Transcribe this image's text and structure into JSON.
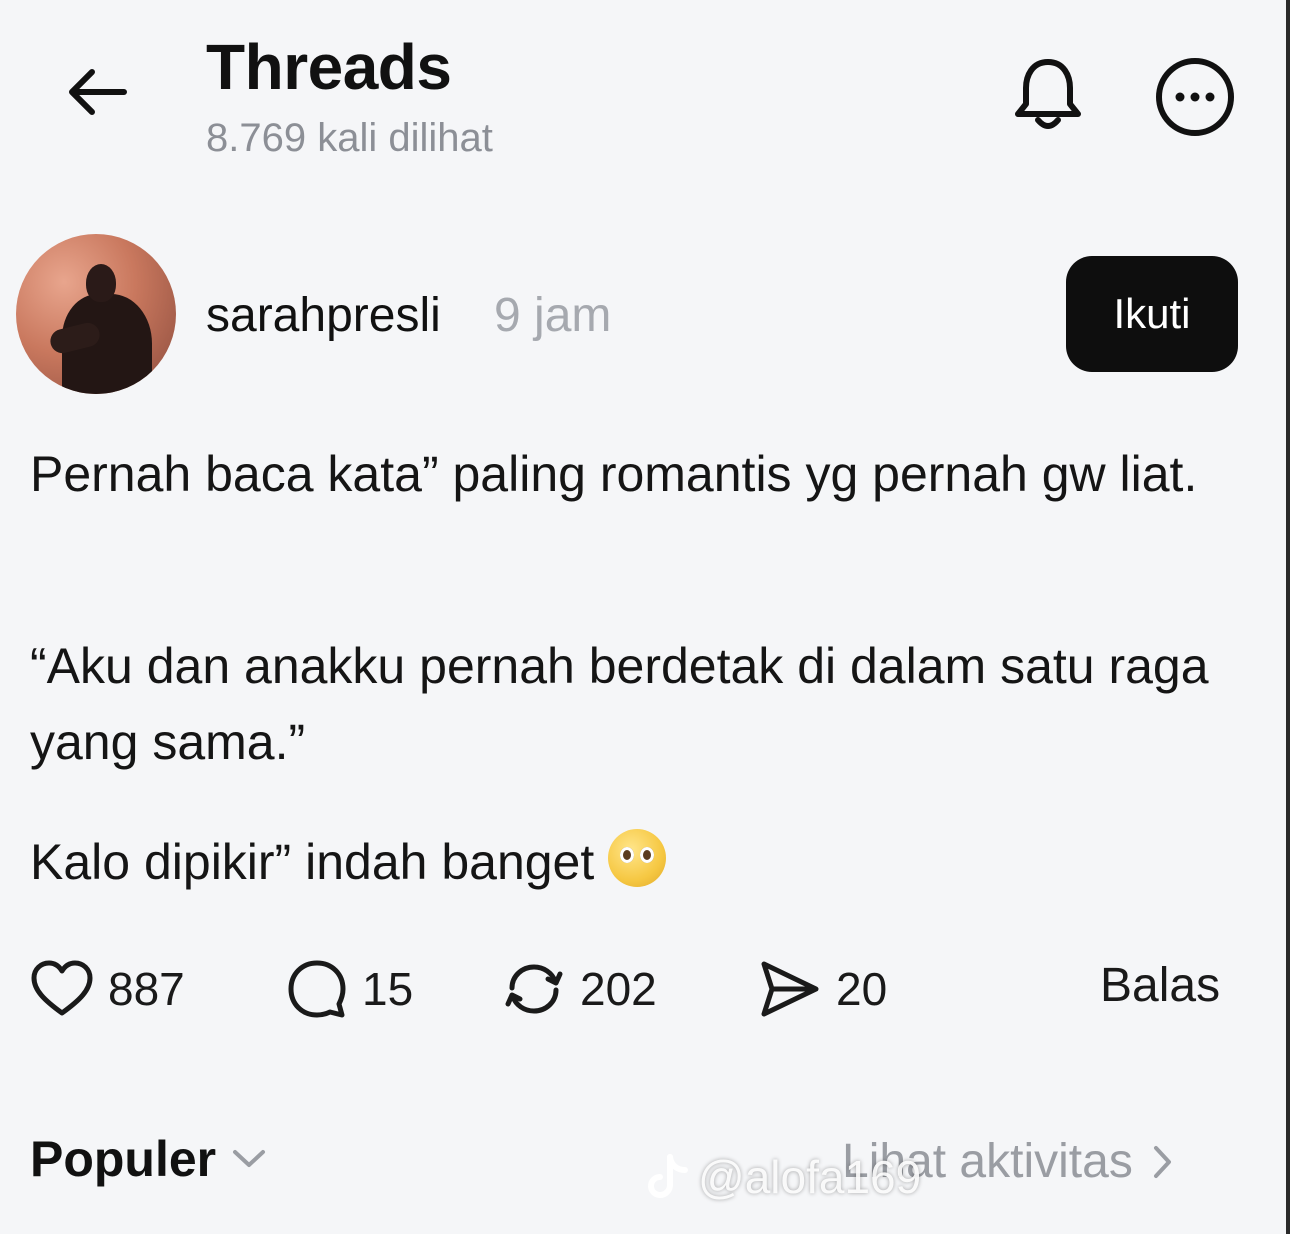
{
  "header": {
    "title": "Threads",
    "views": "8.769 kali dilihat",
    "icons": {
      "back": "arrow-left-icon",
      "notify": "bell-icon",
      "more": "more-horizontal-circle-icon"
    }
  },
  "post": {
    "username": "sarahpresli",
    "time": "9 jam",
    "follow_label": "Ikuti",
    "paragraphs": [
      "Pernah baca kata” paling romantis yg pernah gw liat.",
      "“Aku dan anakku pernah berdetak di dalam satu raga yang sama.”",
      "Kalo dipikir” indah banget"
    ],
    "emoji": "pleading-face-emoji",
    "actions": {
      "likes": "887",
      "replies": "15",
      "reposts": "202",
      "shares": "20",
      "reply_label": "Balas"
    }
  },
  "footer": {
    "sort_label": "Populer",
    "activity_label": "Lihat aktivitas"
  },
  "watermark": "@alofa169"
}
